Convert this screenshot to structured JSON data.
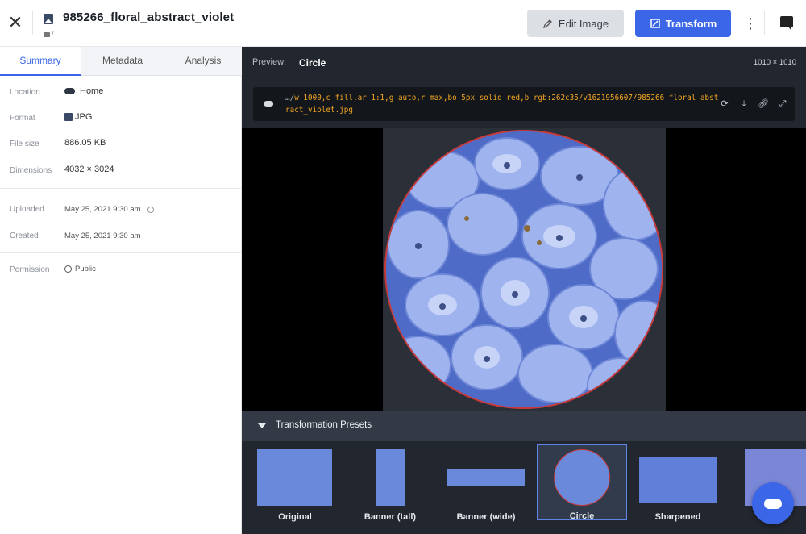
{
  "header": {
    "title": "985266_floral_abstract_violet",
    "folder_path": "/",
    "edit_label": "Edit Image",
    "transform_label": "Transform"
  },
  "tabs": [
    {
      "label": "Summary"
    },
    {
      "label": "Metadata"
    },
    {
      "label": "Analysis"
    }
  ],
  "summary": {
    "location_label": "Location",
    "location_value": "Home",
    "format_label": "Format",
    "format_value": "JPG",
    "filesize_label": "File size",
    "filesize_value": "886.05 KB",
    "dimensions_label": "Dimensions",
    "dimensions_value": "4032 × 3024",
    "uploaded_label": "Uploaded",
    "uploaded_value": "May 25, 2021 9:30 am",
    "created_label": "Created",
    "created_value": "May 25, 2021 9:30 am",
    "permission_label": "Permission",
    "permission_value": "Public"
  },
  "preview": {
    "label": "Preview:",
    "name": "Circle",
    "dimensions": "1010 × 1010",
    "url_prefix": "…/",
    "url": "w_1000,c_fill,ar_1:1,g_auto,r_max,bo_5px_solid_red,b_rgb:262c35/v1621956607/985266_floral_abstract_violet.jpg"
  },
  "presets": {
    "title": "Transformation Presets",
    "items": [
      {
        "label": "Original"
      },
      {
        "label": "Banner (tall)"
      },
      {
        "label": "Banner (wide)"
      },
      {
        "label": "Circle"
      },
      {
        "label": "Sharpened"
      }
    ]
  },
  "colors": {
    "accent": "#3b66e8",
    "border_red": "#c83a3a",
    "dark_panel": "#22262e",
    "url_orange": "#f3a623"
  },
  "icons": [
    "close-icon",
    "image-file-icon",
    "folder-icon",
    "edit-icon",
    "transform-icon",
    "more-vertical-icon",
    "comment-icon",
    "cloud-icon",
    "globe-icon",
    "info-icon",
    "refresh-icon",
    "download-icon",
    "link-icon",
    "expand-icon",
    "upload-cloud-icon",
    "caret-down-icon"
  ]
}
